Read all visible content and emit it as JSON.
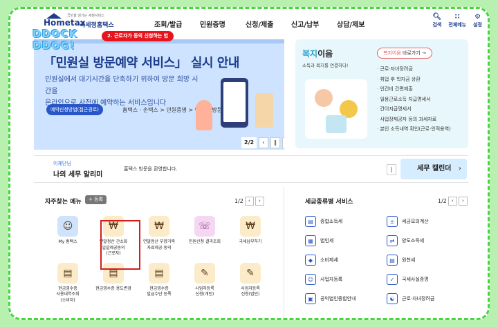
{
  "header": {
    "logo_tiny": "국민을 섬기는 세정서비스",
    "logo_text": "Hometax",
    "logo_korean": "국세청홈택스",
    "watermark": "DDOCK\nDDOG!",
    "nav": [
      "조회/발급",
      "민원증명",
      "신청/제출",
      "신고/납부",
      "상담/제보"
    ],
    "tools": [
      {
        "label": "검색",
        "icon": "search-icon"
      },
      {
        "label": "전체메뉴",
        "icon": "grid-menu-icon"
      },
      {
        "label": "설정",
        "icon": "gear-icon"
      }
    ]
  },
  "callout": "2. 근로자가 동의 신청하는 법",
  "banner": {
    "title": "「민원실 방문예약 서비스」 실시 안내",
    "desc": "민원실에서 대기시간을 단축하기 위하여 방문 희망 시간을\n온라인으로 사전에 예약하는 서비스입니다",
    "tag": "예약신청방법(접근경로)",
    "path": "홈택스 · 손택스 > 민원증명 > 민원실 방문예약",
    "pager": "2/2"
  },
  "welfare": {
    "title_a": "복지",
    "title_b": "이음",
    "sub": "소득과 복지를 연결하다!",
    "go_a": "복지이음",
    "go_b": " 바로가기",
    "items": [
      "근로·자녀장려금",
      "취업 후 학자금 상환",
      "인건비 간편제출",
      "일용근로소득 지급명세서",
      "간이지급명세서",
      "사업장제공자 등의 과세자료",
      "본인 소득내역 확인(근로·인적용역)"
    ]
  },
  "notice": {
    "label": "이체단님",
    "title": "나의 세무 알리미",
    "message": "홈택스 방문을 환영합니다.",
    "calendar": "세무 캘린더"
  },
  "favorites": {
    "title": "자주찾는 메뉴",
    "add": "+ 등록",
    "page": "1/2",
    "items": [
      {
        "label": "My 홈택스",
        "icon": "person-icon"
      },
      {
        "label": "연말정산 간소화\n일괄제공동의\n(근로자)",
        "icon": "money-bag-icon"
      },
      {
        "label": "연말정산 부양가족\n자료제공 동의",
        "icon": "money-bag-icon"
      },
      {
        "label": "민원신청 결과조회",
        "icon": "headset-icon"
      },
      {
        "label": "국세납부하기",
        "icon": "money-bag-icon"
      },
      {
        "label": "현금영수증\n사용내역조회\n(소비자)",
        "icon": "receipt-icon"
      },
      {
        "label": "현금영수증 용도변경",
        "icon": "receipt-icon"
      },
      {
        "label": "현금영수증\n발급수단 등록",
        "icon": "receipt-icon"
      },
      {
        "label": "사업자등록\n신청(개인)",
        "icon": "pencil-doc-icon"
      },
      {
        "label": "사업자등록\n신청(법인)",
        "icon": "pencil-doc-icon"
      }
    ]
  },
  "tax": {
    "title": "세금종류별 서비스",
    "page": "1/2",
    "items": [
      {
        "label": "종합소득세",
        "icon": "car-icon"
      },
      {
        "label": "세금모의계산",
        "icon": "calculator-icon"
      },
      {
        "label": "법인세",
        "icon": "building-icon"
      },
      {
        "label": "양도소득세",
        "icon": "transfer-doc-icon"
      },
      {
        "label": "소비제세",
        "icon": "diamond-icon"
      },
      {
        "label": "원천세",
        "icon": "document-icon"
      },
      {
        "label": "사업자등록",
        "icon": "person-icon"
      },
      {
        "label": "국세사실증명",
        "icon": "certificate-icon"
      },
      {
        "label": "공익법인종합안내",
        "icon": "clipboard-icon"
      },
      {
        "label": "근로·자녀장려금",
        "icon": "handshake-icon"
      }
    ]
  }
}
